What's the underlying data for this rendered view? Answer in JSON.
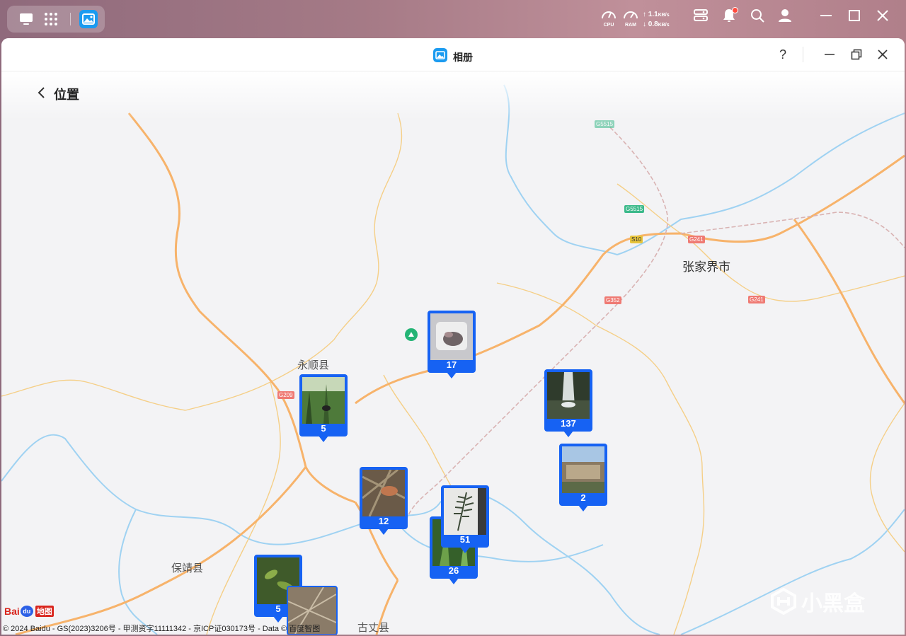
{
  "taskbar": {
    "cpu_label": "CPU",
    "ram_label": "RAM",
    "upload_speed": "1.1",
    "download_speed": "0.8",
    "speed_unit": "KB/s"
  },
  "window": {
    "title": "相册",
    "help_label": "?"
  },
  "page": {
    "title": "位置"
  },
  "map": {
    "places": {
      "zhangjiajie": "张家界市",
      "yongshun": "永顺县",
      "baojing": "保靖县",
      "guzhang": "古丈县"
    },
    "roads": {
      "g5515_top": "G5515",
      "g5515": "G5515",
      "s10": "S10",
      "g241_a": "G241",
      "g241_b": "G241",
      "g352": "G352",
      "g209": "G209"
    },
    "markers": [
      {
        "id": "m17",
        "count": "17"
      },
      {
        "id": "m5a",
        "count": "5"
      },
      {
        "id": "m137",
        "count": "137"
      },
      {
        "id": "m2",
        "count": "2"
      },
      {
        "id": "m12",
        "count": "12"
      },
      {
        "id": "m26",
        "count": "26"
      },
      {
        "id": "m51",
        "count": "51"
      },
      {
        "id": "m5b",
        "count": "5"
      }
    ],
    "logo_text": "Bai",
    "logo_du": "du",
    "logo_ditu": "地图",
    "copyright": "© 2024 Baidu - GS(2023)3206号 - 甲测资字11111342 - 京ICP证030173号 - Data © 百度智图"
  },
  "watermark": "小黑盒"
}
